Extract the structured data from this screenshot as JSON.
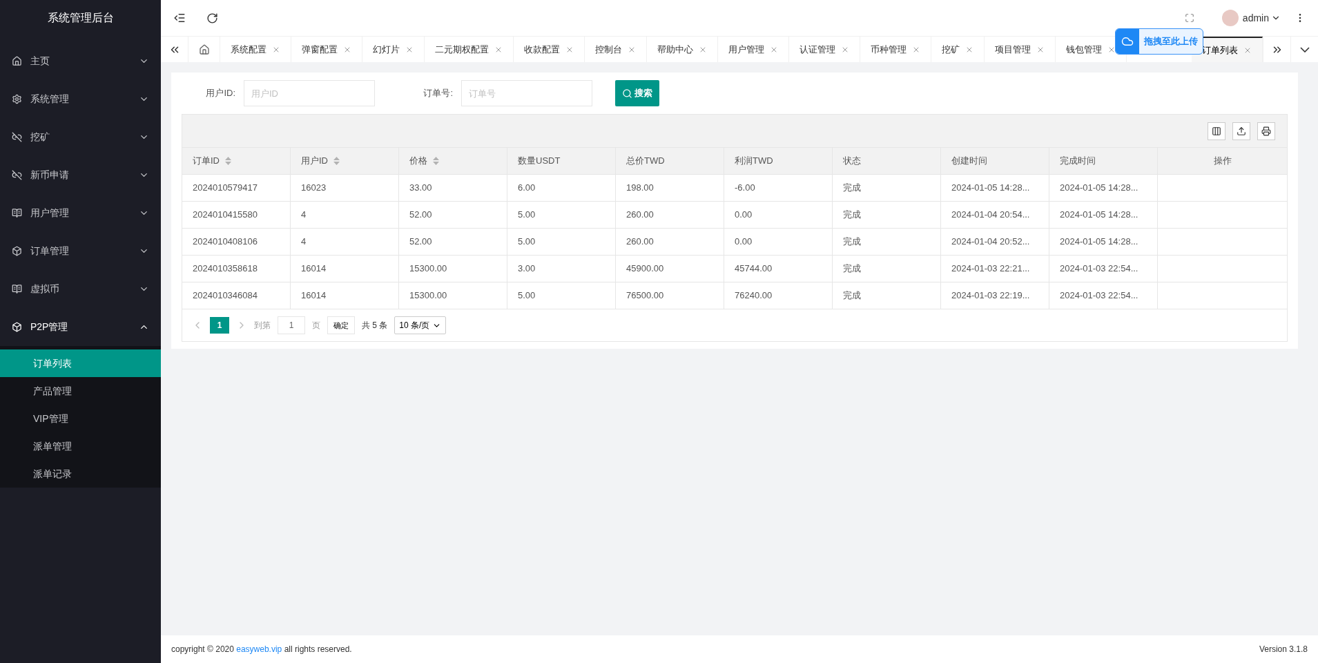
{
  "sidebar": {
    "title": "系统管理后台",
    "items": [
      {
        "label": "主页",
        "expanded": false
      },
      {
        "label": "系统管理",
        "expanded": false
      },
      {
        "label": "挖矿",
        "expanded": false
      },
      {
        "label": "新币申请",
        "expanded": false
      },
      {
        "label": "用户管理",
        "expanded": false
      },
      {
        "label": "订单管理",
        "expanded": false
      },
      {
        "label": "虚拟币",
        "expanded": false
      },
      {
        "label": "P2P管理",
        "expanded": true,
        "children": [
          {
            "label": "订单列表",
            "selected": true
          },
          {
            "label": "产品管理",
            "selected": false
          },
          {
            "label": "VIP管理",
            "selected": false
          },
          {
            "label": "派单管理",
            "selected": false
          },
          {
            "label": "派单记录",
            "selected": false
          }
        ]
      }
    ]
  },
  "header": {
    "user": "admin"
  },
  "tabs": [
    {
      "label": "系统配置",
      "selected": false
    },
    {
      "label": "弹窗配置",
      "selected": false
    },
    {
      "label": "幻灯片",
      "selected": false
    },
    {
      "label": "二元期权配置",
      "selected": false
    },
    {
      "label": "收款配置",
      "selected": false
    },
    {
      "label": "控制台",
      "selected": false
    },
    {
      "label": "帮助中心",
      "selected": false
    },
    {
      "label": "用户管理",
      "selected": false
    },
    {
      "label": "认证管理",
      "selected": false
    },
    {
      "label": "币种管理",
      "selected": false
    },
    {
      "label": "挖矿",
      "selected": false
    },
    {
      "label": "项目管理",
      "selected": false
    },
    {
      "label": "钱包管理",
      "selected": false
    },
    {
      "label": "订单列表",
      "selected": true
    }
  ],
  "upload_overlay": {
    "label": "拖拽至此上传"
  },
  "filters": [
    {
      "label": "用户ID:",
      "placeholder": "用户ID"
    },
    {
      "label": "订单号:",
      "placeholder": "订单号"
    }
  ],
  "search_button": "搜索",
  "table": {
    "columns": [
      {
        "label": "订单ID",
        "sortable": true
      },
      {
        "label": "用户ID",
        "sortable": true
      },
      {
        "label": "价格",
        "sortable": true
      },
      {
        "label": "数量USDT",
        "sortable": false
      },
      {
        "label": "总价TWD",
        "sortable": false
      },
      {
        "label": "利润TWD",
        "sortable": false
      },
      {
        "label": "状态",
        "sortable": false
      },
      {
        "label": "创建时间",
        "sortable": false
      },
      {
        "label": "完成时间",
        "sortable": false
      },
      {
        "label": "操作",
        "sortable": false
      }
    ],
    "rows": [
      [
        "2024010579417",
        "16023",
        "33.00",
        "6.00",
        "198.00",
        "-6.00",
        "完成",
        "2024-01-05 14:28...",
        "2024-01-05 14:28..."
      ],
      [
        "2024010415580",
        "4",
        "52.00",
        "5.00",
        "260.00",
        "0.00",
        "完成",
        "2024-01-04 20:54...",
        "2024-01-05 14:28..."
      ],
      [
        "2024010408106",
        "4",
        "52.00",
        "5.00",
        "260.00",
        "0.00",
        "完成",
        "2024-01-04 20:52...",
        "2024-01-05 14:28..."
      ],
      [
        "2024010358618",
        "16014",
        "15300.00",
        "3.00",
        "45900.00",
        "45744.00",
        "完成",
        "2024-01-03 22:21...",
        "2024-01-03 22:54..."
      ],
      [
        "2024010346084",
        "16014",
        "15300.00",
        "5.00",
        "76500.00",
        "76240.00",
        "完成",
        "2024-01-03 22:19...",
        "2024-01-03 22:54..."
      ]
    ]
  },
  "pagination": {
    "current": "1",
    "goto_label": "到第",
    "goto_value": "1",
    "page_unit": "页",
    "confirm": "确定",
    "total": "共 5 条",
    "page_size": "10 条/页"
  },
  "footer": {
    "copyright_prefix": "copyright © 2020",
    "link": "easyweb.vip",
    "copyright_suffix": "all rights reserved.",
    "version": "Version 3.1.8"
  }
}
